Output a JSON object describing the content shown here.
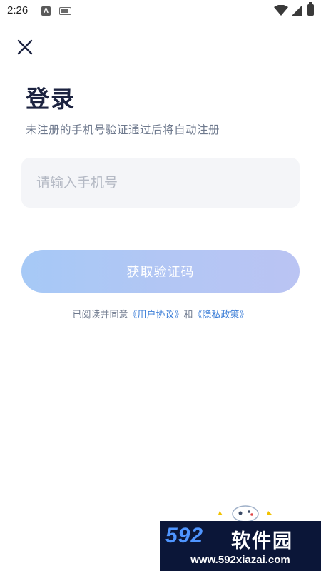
{
  "status_bar": {
    "time": "2:26",
    "notification_icons": [
      "a-app-icon",
      "keyboard-icon"
    ],
    "system_icons": [
      "wifi-icon",
      "signal-icon",
      "battery-icon"
    ]
  },
  "header": {
    "close_icon": "close-icon"
  },
  "login": {
    "title": "登录",
    "subtitle": "未注册的手机号验证通过后将自动注册",
    "phone_placeholder": "请输入手机号",
    "phone_value": "",
    "get_code_label": "获取验证码"
  },
  "agreement": {
    "prefix": "已阅读并同意",
    "user_agreement": "《用户协议》",
    "connector": "和",
    "privacy_policy": "《隐私政策》"
  },
  "watermark": {
    "logo": "592",
    "name": "软件园",
    "url": "www.592xiazai.com"
  },
  "colors": {
    "title": "#1c2340",
    "subtitle": "#6f7a8e",
    "input_bg": "#f4f5f8",
    "button_gradient_start": "#a6c9f6",
    "button_gradient_end": "#bac4f3",
    "link": "#3d7fd8"
  }
}
